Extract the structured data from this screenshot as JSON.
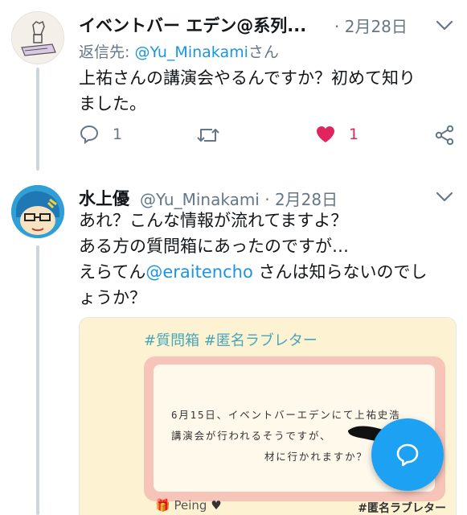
{
  "tweet1": {
    "name": "イベントバー エデン@系列...",
    "date": "· 2月28日",
    "reply_label": "返信先: ",
    "reply_handle": "@Yu_Minakami",
    "reply_suffix": "さん",
    "text_line1": "上祐さんの講演会やるんですか？初めて知り",
    "text_line2": "ました。",
    "reply_count": "1",
    "like_count": "1"
  },
  "tweet2": {
    "name": "水上優",
    "handle_date": "@Yu_Minakami · 2月28日",
    "text_line1": "あれ？こんな情報が流れてますよ？",
    "text_line2": "ある方の質問箱にあったのですが…",
    "text_line3_pre": "えらてん",
    "text_line3_mention": "@eraitencho",
    "text_line3_post": " さんは知らないのでし",
    "text_line4": "ょうか？",
    "card": {
      "top_tag": "#質問箱 #匿名ラブレター",
      "q_line1": "6月15日、イベントバーエデンにて上祐史浩",
      "q_line2": "講演会が行われるそうですが、",
      "q_line3": "材に行かれますか？",
      "logo": "Peing",
      "footer_tag": "#匿名ラブレター"
    }
  },
  "colors": {
    "accent": "#1da1f2",
    "like": "#e0245e",
    "muted": "#657786"
  },
  "icons": {
    "reply": "reply-icon",
    "retweet": "retweet-icon",
    "like": "heart-icon",
    "share": "share-icon",
    "caret": "chevron-down-icon",
    "compose": "compose-reply-icon"
  }
}
